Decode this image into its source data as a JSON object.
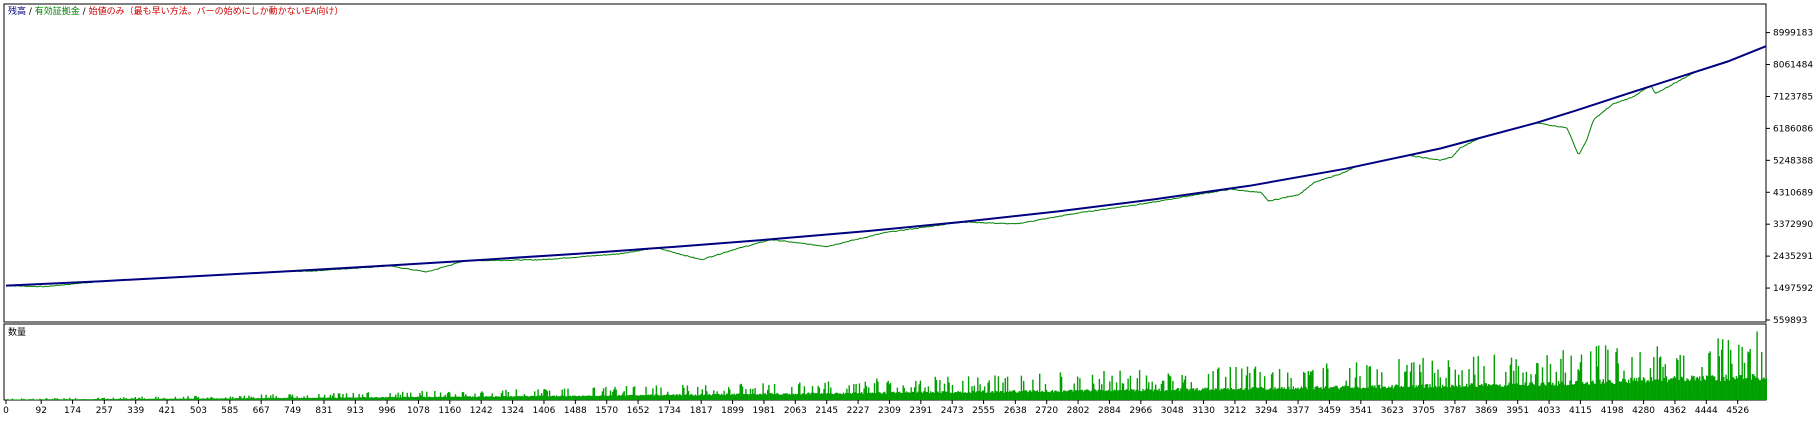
{
  "legend": {
    "balance": "残高",
    "sep1": " / ",
    "equity": "有効証拠金",
    "sep2": " / ",
    "mode": "始値のみ（最も早い方法。バーの始めにしか動かないEA向け）"
  },
  "volume_label": "数量",
  "colors": {
    "balance": "#000080",
    "equity": "#008000",
    "volume": "#00a000",
    "legend_red": "#cc0000",
    "frame": "#000000",
    "grid": "#c0c0c0"
  },
  "chart_data": [
    {
      "type": "line",
      "title": "",
      "ylim": [
        559893,
        9780000
      ],
      "xlim": [
        0,
        4600
      ],
      "y_ticks": [
        559893,
        1497592,
        2435291,
        3372990,
        4310689,
        5248388,
        6186086,
        7123785,
        8061484,
        8999183
      ],
      "series": [
        {
          "name": "残高",
          "x": [
            0,
            250,
            500,
            750,
            1000,
            1250,
            1500,
            1750,
            2000,
            2250,
            2500,
            2750,
            3000,
            3250,
            3500,
            3750,
            4000,
            4100,
            4250,
            4500,
            4600
          ],
          "values": [
            1570000,
            1700000,
            1850000,
            2000000,
            2160000,
            2330000,
            2510000,
            2710000,
            2930000,
            3170000,
            3440000,
            3750000,
            4100000,
            4500000,
            5000000,
            5600000,
            6350000,
            6700000,
            7250000,
            8150000,
            8600000
          ]
        },
        {
          "name": "有効証拠金",
          "x": [
            0,
            100,
            250,
            400,
            600,
            800,
            1000,
            1100,
            1200,
            1400,
            1600,
            1700,
            1817,
            1900,
            2000,
            2145,
            2300,
            2500,
            2640,
            2800,
            3000,
            3100,
            3200,
            3280,
            3300,
            3380,
            3420,
            3500,
            3600,
            3750,
            3780,
            3800,
            3900,
            4000,
            4080,
            4110,
            4130,
            4150,
            4200,
            4250,
            4300,
            4310,
            4400,
            4430,
            4450,
            4500,
            4600
          ],
          "values": [
            1570000,
            1540000,
            1700000,
            1850000,
            1950000,
            2000000,
            2150000,
            1970000,
            2300000,
            2330000,
            2500000,
            2680000,
            2330000,
            2620000,
            2920000,
            2720000,
            3130000,
            3440000,
            3380000,
            3700000,
            4020000,
            4220000,
            4400000,
            4300000,
            4050000,
            4250000,
            4600000,
            4900000,
            5500000,
            5250000,
            5350000,
            5600000,
            6200000,
            6350000,
            6200000,
            5400000,
            5800000,
            6450000,
            6900000,
            7100000,
            7450000,
            7200000,
            7750000,
            7950000,
            8150000,
            8300000,
            8600000
          ]
        }
      ]
    },
    {
      "type": "bar",
      "title": "数量",
      "x_ticks": [
        "0",
        "92",
        "174",
        "257",
        "339",
        "421",
        "503",
        "585",
        "667",
        "749",
        "831",
        "913",
        "996",
        "1078",
        "1160",
        "1242",
        "1324",
        "1406",
        "1488",
        "1570",
        "1652",
        "1734",
        "1817",
        "1899",
        "1981",
        "2063",
        "2145",
        "2227",
        "2309",
        "2391",
        "2473",
        "2555",
        "2638",
        "2720",
        "2802",
        "2884",
        "2966",
        "3048",
        "3130",
        "3212",
        "3294",
        "3377",
        "3459",
        "3541",
        "3623",
        "3705",
        "3787",
        "3869",
        "3951",
        "4033",
        "4115",
        "4198",
        "4280",
        "4362",
        "4444",
        "4526"
      ],
      "xlim": [
        0,
        4600
      ],
      "ylim": [
        0,
        1
      ],
      "series": [
        {
          "name": "",
          "x": [
            0,
            500,
            1000,
            1500,
            2000,
            2500,
            3000,
            3500,
            4000,
            4300,
            4600
          ],
          "values": [
            0.02,
            0.06,
            0.12,
            0.18,
            0.26,
            0.35,
            0.44,
            0.55,
            0.68,
            0.88,
            1.0
          ]
        }
      ]
    }
  ]
}
